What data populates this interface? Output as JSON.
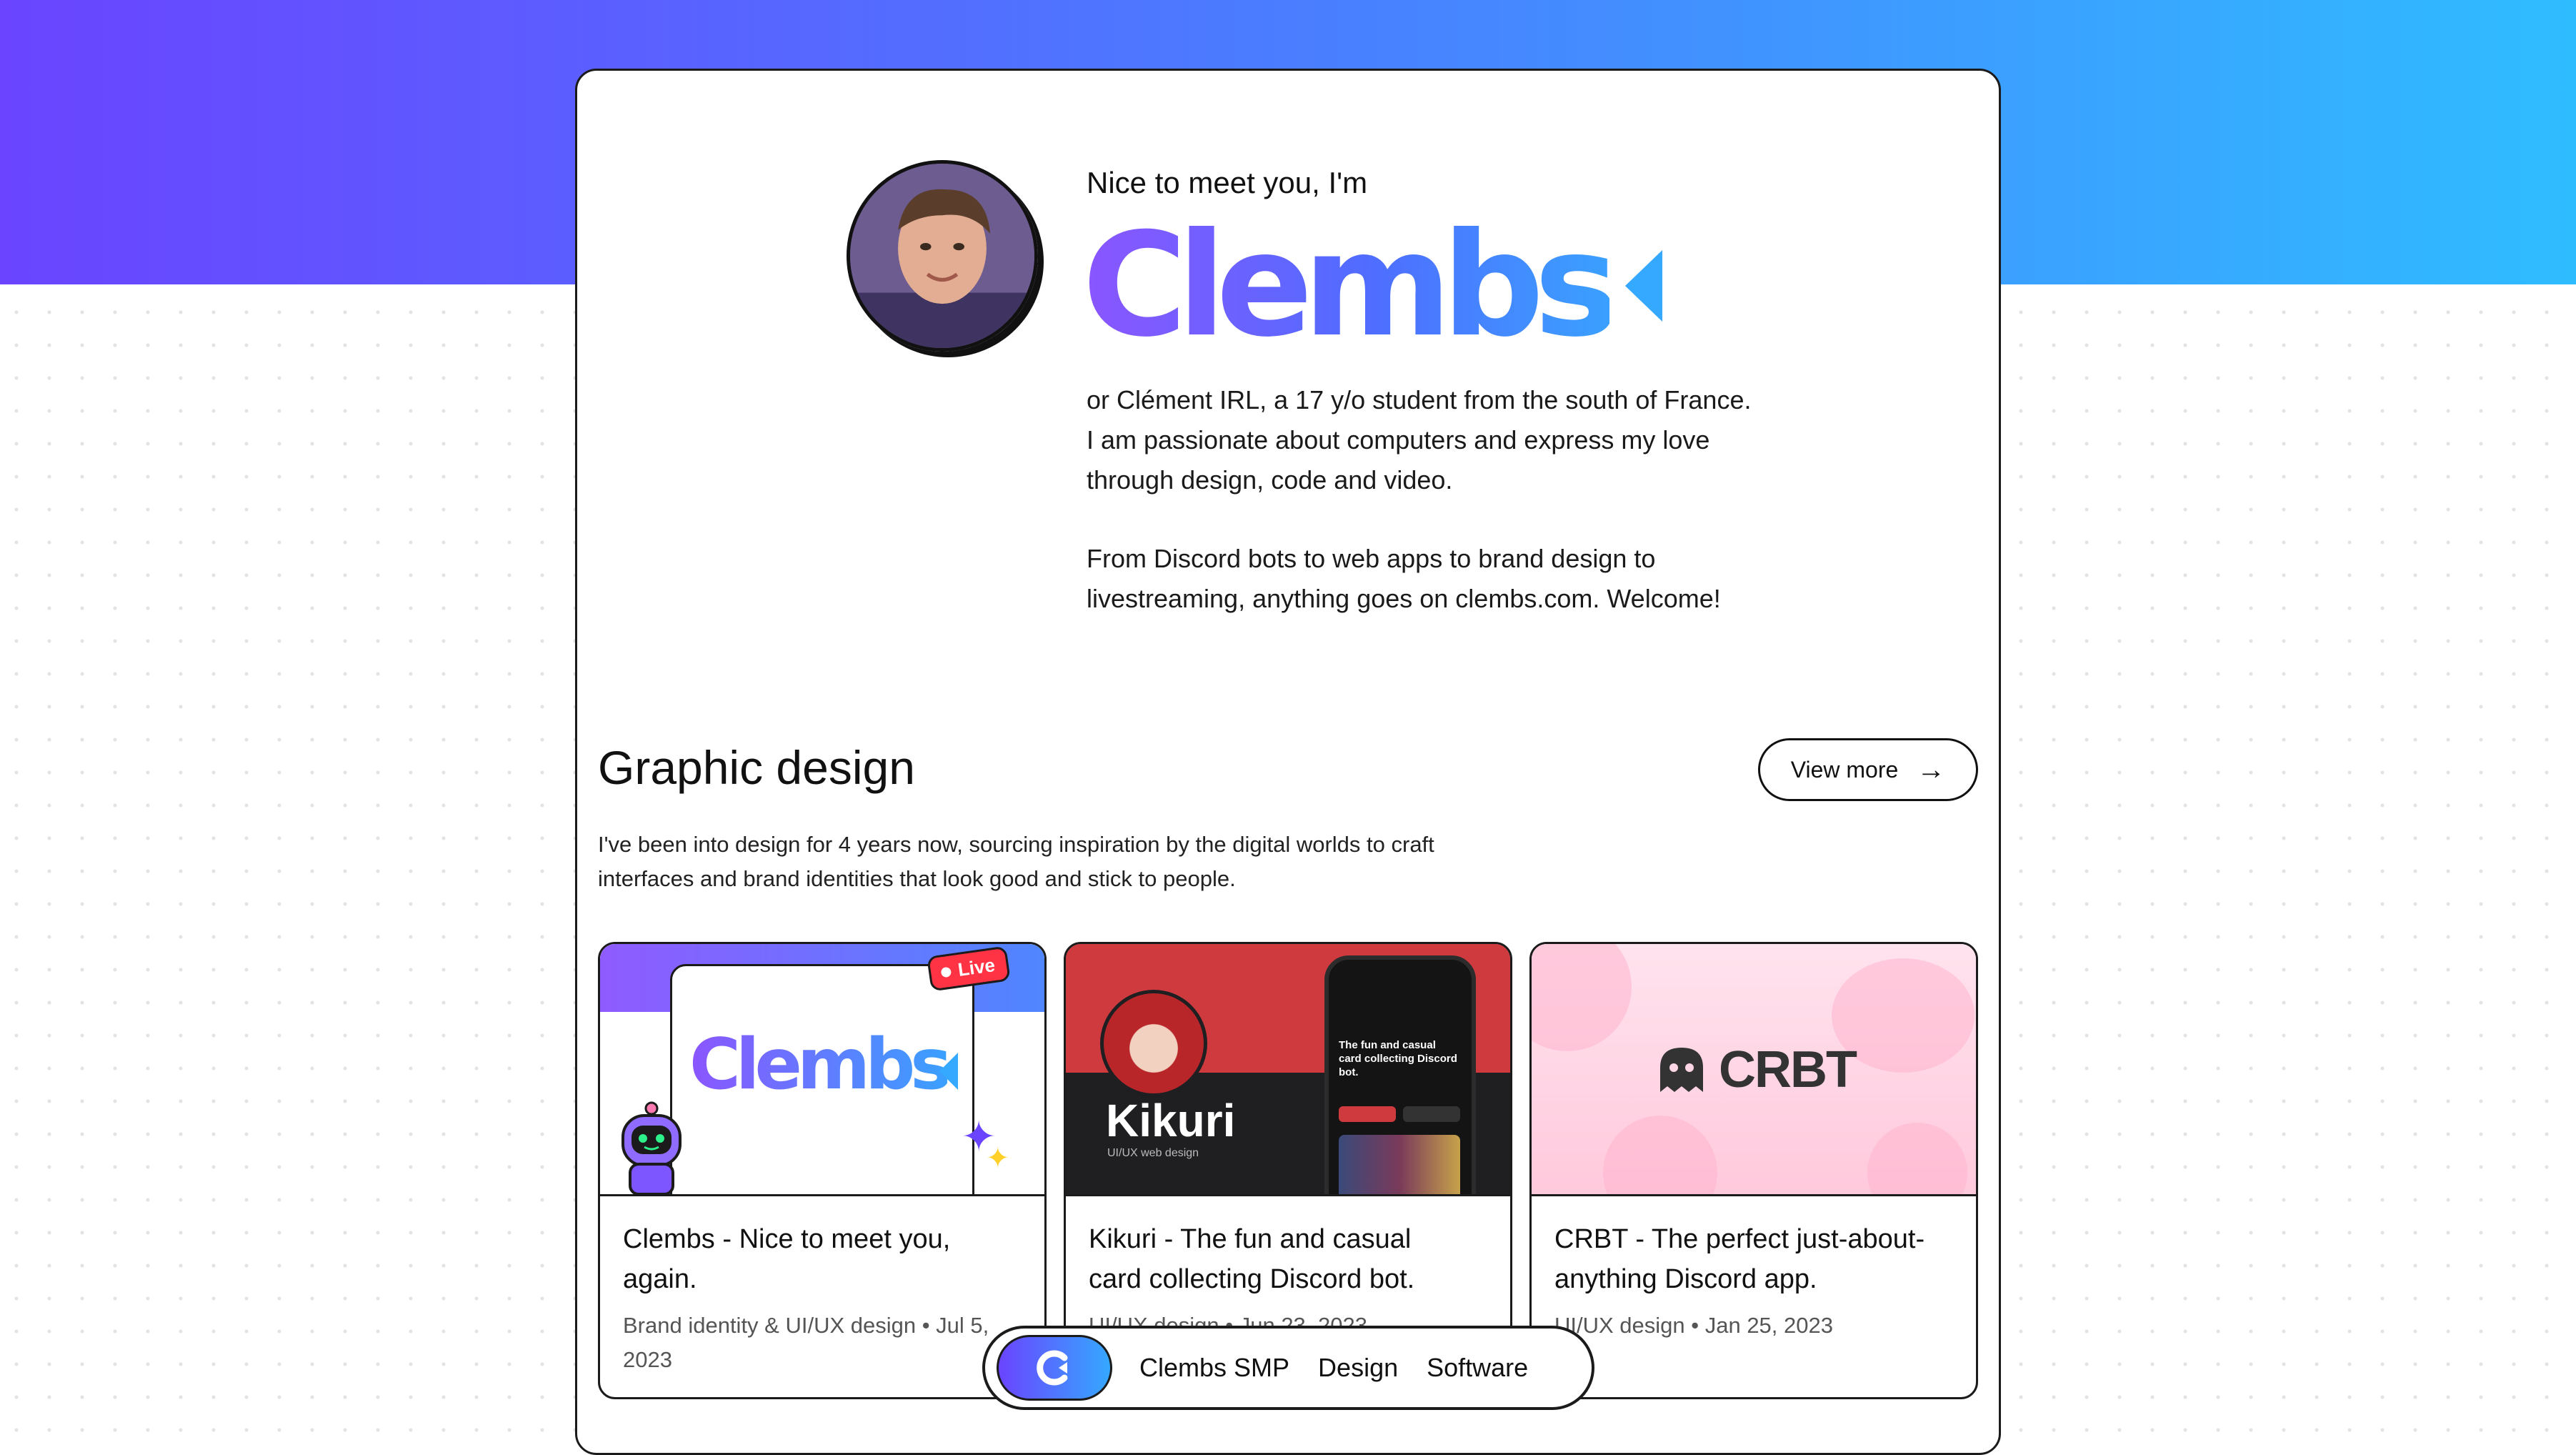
{
  "hero": {
    "greeting": "Nice to meet you, I'm",
    "logo_text": "Clembs",
    "bio_paragraph_1": "or Clément IRL, a 17 y/o student from the south of France. I am passionate about computers and express my love through design, code and video.",
    "bio_paragraph_2": "From Discord bots to web apps to brand design to livestreaming, anything goes on clembs.com. Welcome!"
  },
  "graphic_design": {
    "title": "Graphic design",
    "view_more_label": "View more",
    "description": "I've been into design for 4 years now, sourcing inspiration by the digital worlds to craft interfaces and brand identities that look good and stick to people.",
    "projects": [
      {
        "title": "Clembs - Nice to meet you, again.",
        "meta": "Brand identity & UI/UX design • Jul 5, 2023",
        "thumb_logo": "Clembs",
        "thumb_badge": "Live"
      },
      {
        "title": "Kikuri - The fun and casual card collecting Discord bot.",
        "meta": "UI/UX design • Jun 23, 2023",
        "thumb_name": "Kikuri",
        "thumb_sub": "UI/UX web design",
        "thumb_phone_text": "The fun and casual card collecting Discord bot."
      },
      {
        "title": "CRBT - The perfect just-about-anything Discord app.",
        "meta": "UI/UX design • Jan 25, 2023",
        "thumb_logo": "CRBT"
      }
    ]
  },
  "bottom_nav": {
    "items": [
      "Clembs SMP",
      "Design",
      "Software"
    ]
  },
  "colors": {
    "gradient_start": "#6a44ff",
    "gradient_end": "#2fbcff",
    "accent_red": "#cf3a3f",
    "pink": "#ffc9dc"
  }
}
